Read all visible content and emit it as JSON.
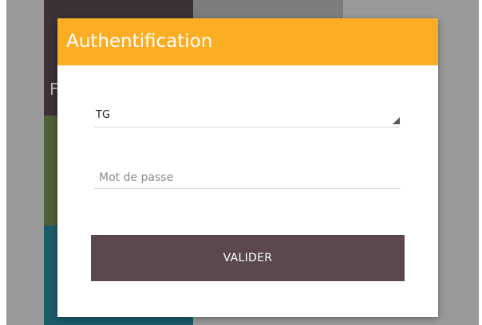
{
  "background": {
    "partial_letter": "F"
  },
  "dialog": {
    "title": "Authentification",
    "user_select": {
      "selected": "TG"
    },
    "password": {
      "value": "",
      "placeholder": "Mot de passe"
    },
    "submit_label": "VALIDER"
  },
  "colors": {
    "header": "#fbad24",
    "button": "#5a4750",
    "backdrop": "#9a9a9a"
  },
  "icons": {
    "select_arrow": "dropdown-triangle-icon"
  }
}
